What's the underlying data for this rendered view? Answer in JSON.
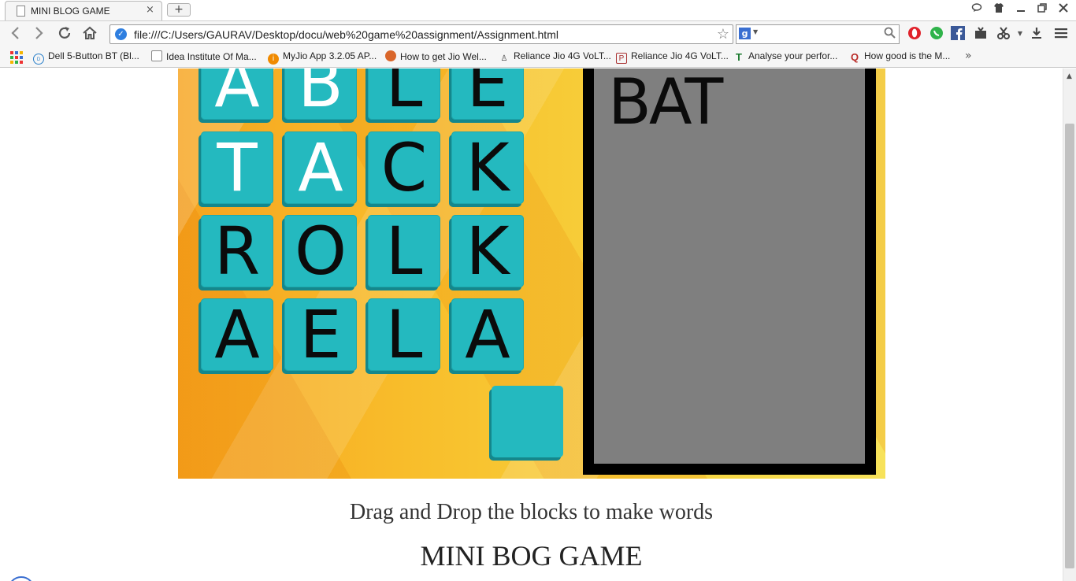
{
  "browser": {
    "tab_title": "MINI BLOG GAME",
    "tab_close": "×",
    "new_tab": "+",
    "url": "file:///C:/Users/GAURAV/Desktop/docu/web%20game%20assignment/Assignment.html",
    "search_value": "",
    "bookmarks": [
      "Dell 5-Button BT (Bl...",
      "Idea Institute Of Ma...",
      "MyJio App 3.2.05 AP...",
      "How to get Jio Wel...",
      "Reliance Jio 4G VoLT...",
      "Reliance Jio 4G VoLT...",
      "Analyse your perfor...",
      "How good is the M..."
    ],
    "bookmarks_more": "»"
  },
  "game": {
    "grid": [
      [
        "A",
        "B",
        "L",
        "E"
      ],
      [
        "T",
        "A",
        "C",
        "K"
      ],
      [
        "R",
        "O",
        "L",
        "K"
      ],
      [
        "A",
        "E",
        "L",
        "A"
      ]
    ],
    "answer_word": "BAT"
  },
  "page": {
    "instruction": "Drag and Drop the blocks to make words",
    "heading": "MINI BOG GAME"
  },
  "colors": {
    "tile": "#24b9bf",
    "tile_shadow": "#14878c",
    "answer_box": "#7f7f7f"
  }
}
